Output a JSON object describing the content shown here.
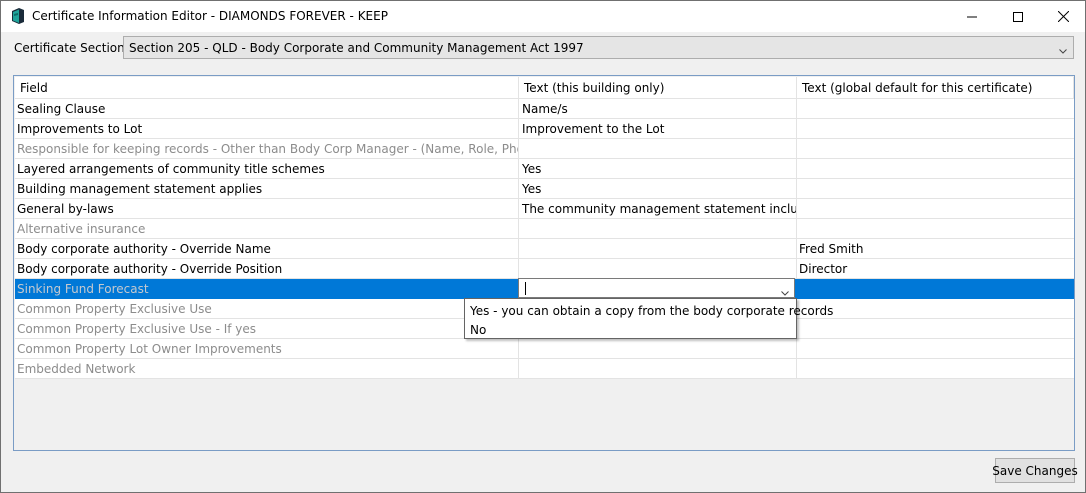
{
  "window": {
    "title": "Certificate Information Editor - DIAMONDS FOREVER - KEEP"
  },
  "section": {
    "label": "Certificate Section:",
    "selected": "Section 205 - QLD - Body Corporate and Community Management Act 1997"
  },
  "grid": {
    "columns": [
      "Field",
      "Text (this building only)",
      "Text (global default for this certificate)"
    ],
    "rows": [
      {
        "field": "Sealing Clause",
        "building": "Name/s",
        "global": "",
        "dim": false
      },
      {
        "field": "Improvements to Lot",
        "building": "Improvement to the Lot",
        "global": "",
        "dim": false
      },
      {
        "field": "Responsible for keeping records - Other than Body Corp Manager - (Name, Role, Phone, Email)",
        "building": "",
        "global": "",
        "dim": true
      },
      {
        "field": "Layered arrangements of community title schemes",
        "building": "Yes",
        "global": "",
        "dim": false
      },
      {
        "field": "Building management statement applies",
        "building": "Yes",
        "global": "",
        "dim": false
      },
      {
        "field": "General by-laws",
        "building": "The community management statement includes…",
        "global": "",
        "dim": false
      },
      {
        "field": "Alternative insurance",
        "building": "",
        "global": "",
        "dim": true
      },
      {
        "field": "Body corporate authority - Override Name",
        "building": "",
        "global": "Fred Smith",
        "dim": false
      },
      {
        "field": "Body corporate authority - Override Position",
        "building": "",
        "global": "Director",
        "dim": false
      },
      {
        "field": "Sinking Fund Forecast",
        "building": "",
        "global": "",
        "dim": true,
        "selected": true
      },
      {
        "field": "Common Property Exclusive Use",
        "building": "",
        "global": "",
        "dim": true
      },
      {
        "field": "Common Property Exclusive Use - If yes",
        "building": "",
        "global": "",
        "dim": true
      },
      {
        "field": "Common Property Lot Owner Improvements",
        "building": "",
        "global": "",
        "dim": true
      },
      {
        "field": "Embedded Network",
        "building": "",
        "global": "",
        "dim": true
      }
    ]
  },
  "dropdown": {
    "options": [
      "Yes - you can obtain a copy from the body corporate records",
      "No"
    ]
  },
  "footer": {
    "save_label": "Save Changes"
  },
  "colors": {
    "selection": "#0078d7",
    "grid_border": "#7a9cc5"
  }
}
